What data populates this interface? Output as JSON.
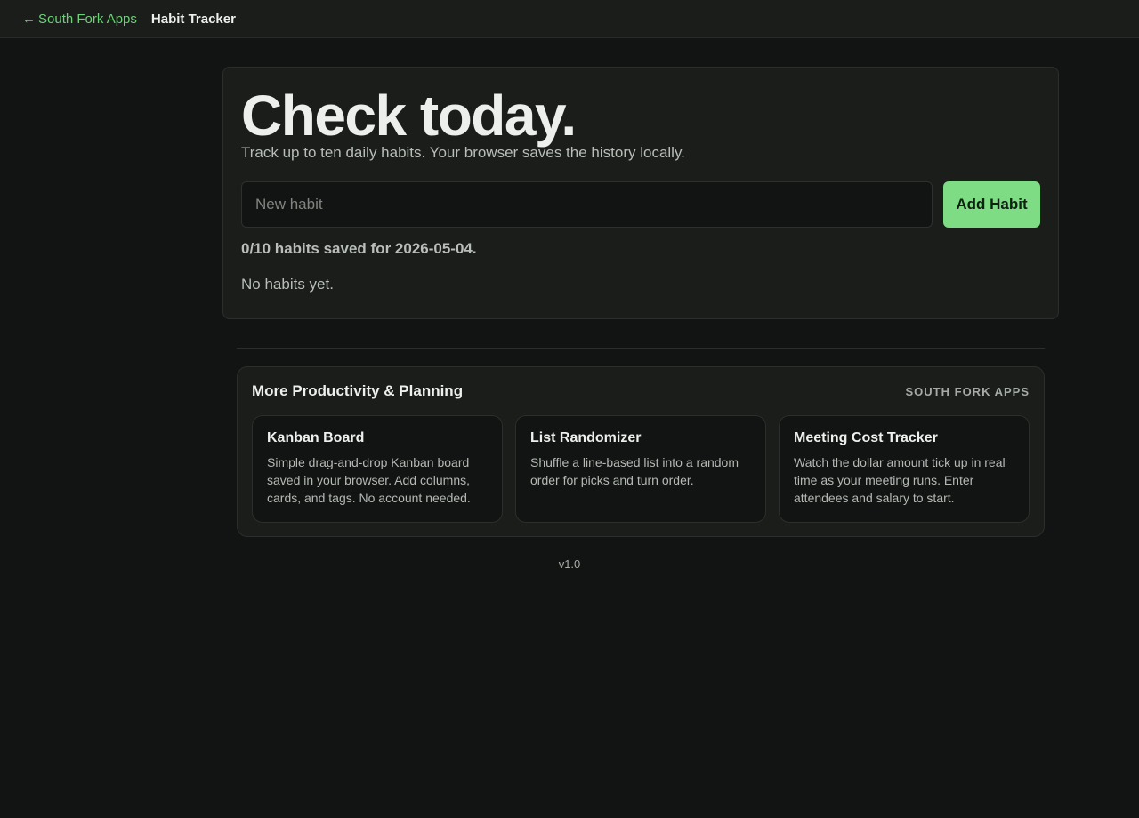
{
  "topbar": {
    "back_label": "South Fork Apps",
    "current_page": "Habit Tracker"
  },
  "hero": {
    "title": "Check today.",
    "subtitle": "Track up to ten daily habits. Your browser saves the history locally.",
    "input_placeholder": "New habit",
    "input_value": "",
    "add_button_label": "Add Habit",
    "status_text": "0/10 habits saved for 2026-05-04.",
    "empty_text": "No habits yet."
  },
  "more": {
    "title": "More Productivity & Planning",
    "brand": "SOUTH FORK APPS",
    "cards": [
      {
        "title": "Kanban Board",
        "description": "Simple drag-and-drop Kanban board saved in your browser. Add columns, cards, and tags. No account needed."
      },
      {
        "title": "List Randomizer",
        "description": "Shuffle a line-based list into a random order for picks and turn order."
      },
      {
        "title": "Meeting Cost Tracker",
        "description": "Watch the dollar amount tick up in real time as your meeting runs. Enter attendees and salary to start."
      }
    ]
  },
  "footer": {
    "version": "v1.0"
  },
  "colors": {
    "accent": "#7edc85",
    "link": "#6fd07a",
    "background": "#121413",
    "panel": "#1a1d1a"
  }
}
